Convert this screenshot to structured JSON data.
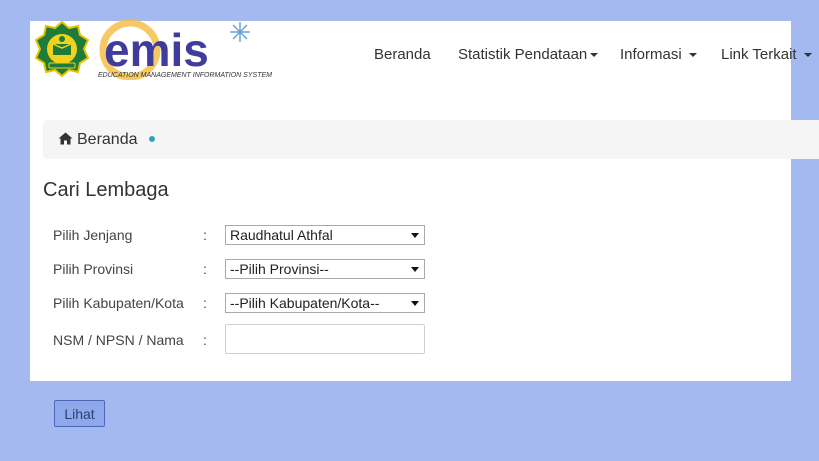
{
  "header": {
    "emis_logo_text": "emis",
    "emis_tagline": "EDUCATION MANAGEMENT INFORMATION SYSTEM",
    "nav": [
      {
        "label": "Beranda",
        "has_caret": false
      },
      {
        "label": "Statistik Pendataan",
        "has_caret": true
      },
      {
        "label": "Informasi",
        "has_caret": true
      },
      {
        "label": "Link Terkait",
        "has_caret": true
      }
    ]
  },
  "breadcrumb": {
    "home_label": "Beranda",
    "home_icon": "home-icon"
  },
  "page": {
    "title": "Cari Lembaga"
  },
  "form": {
    "colon": ":",
    "jenjang": {
      "label": "Pilih Jenjang",
      "selected": "Raudhatul Athfal"
    },
    "provinsi": {
      "label": "Pilih Provinsi",
      "selected": "--Pilih Provinsi--"
    },
    "kabupaten": {
      "label": "Pilih Kabupaten/Kota",
      "selected": "--Pilih Kabupaten/Kota--"
    },
    "search": {
      "label": "NSM / NPSN / Nama",
      "value": "",
      "placeholder": ""
    },
    "submit_label": "Lihat"
  },
  "colors": {
    "page_background": "#a3b9f0",
    "breadcrumb_dot": "#2aa6b8",
    "button_background": "#8ea8ea"
  }
}
